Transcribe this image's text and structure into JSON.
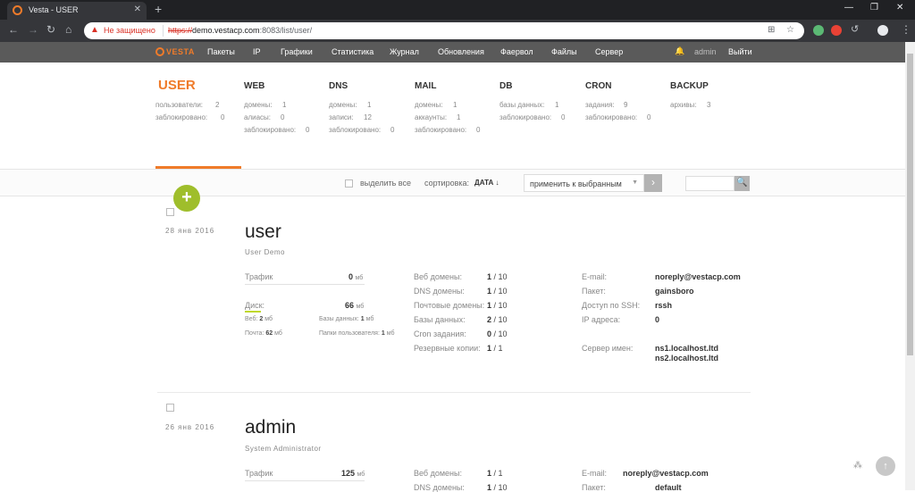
{
  "browser": {
    "tab_title": "Vesta - USER",
    "tab_close": "✕",
    "new_tab": "+",
    "insecure_label": "Не защищено",
    "url_scheme": "https://",
    "url_host": "demo.vestacp.com",
    "url_rest": ":8083/list/user/",
    "win_min": "—",
    "win_max": "❐",
    "win_close": "✕"
  },
  "topmenu": {
    "logo": "VESTA",
    "items": [
      "Пакеты",
      "IP",
      "Графики",
      "Статистика",
      "Журнал",
      "Обновления",
      "Фаервол",
      "Файлы",
      "Сервер"
    ],
    "user": "admin",
    "logout": "Выйти"
  },
  "categories": {
    "user": {
      "title": "USER",
      "l1": "пользователи:",
      "v1": "2",
      "l2": "заблокировано:",
      "v2": "0"
    },
    "web": {
      "title": "WEB",
      "l1": "домены:",
      "v1": "1",
      "l2": "алиасы:",
      "v2": "0",
      "l3": "заблокировано:",
      "v3": "0"
    },
    "dns": {
      "title": "DNS",
      "l1": "домены:",
      "v1": "1",
      "l2": "записи:",
      "v2": "12",
      "l3": "заблокировано:",
      "v3": "0"
    },
    "mail": {
      "title": "MAIL",
      "l1": "домены:",
      "v1": "1",
      "l2": "аккаунты:",
      "v2": "1",
      "l3": "заблокировано:",
      "v3": "0"
    },
    "db": {
      "title": "DB",
      "l1": "базы данных:",
      "v1": "1",
      "l2": "заблокировано:",
      "v2": "0"
    },
    "cron": {
      "title": "CRON",
      "l1": "задания:",
      "v1": "9",
      "l2": "заблокировано:",
      "v2": "0"
    },
    "backup": {
      "title": "BACKUP",
      "l1": "архивы:",
      "v1": "3"
    }
  },
  "toolbar": {
    "select_all": "выделить все",
    "sort_label": "сортировка:",
    "sort_value": "ДАТА ↓",
    "apply_label": "применить к выбранным",
    "apply_arrow": "▼",
    "apply_go": "›",
    "search_icon": "🔍"
  },
  "add_button": "+",
  "users": [
    {
      "date": "28 янв 2016",
      "name": "user",
      "desc": "User Demo",
      "traffic_label": "Трафик",
      "traffic_value": "0",
      "traffic_unit": "мб",
      "disk_label": "Диск:",
      "disk_value": "66",
      "disk_unit": "мб",
      "web_label": "Веб:",
      "web_value": "2",
      "web_unit": "мб",
      "db_label": "Базы данных:",
      "db_value": "1",
      "db_unit": "мб",
      "mail_label": "Почта:",
      "mail_value": "62",
      "mail_unit": "мб",
      "userdirs_label": "Папки пользователя:",
      "userdirs_value": "1",
      "userdirs_unit": "мб",
      "web_domains_label": "Веб домены:",
      "web_domains": "1",
      "web_domains_max": "/ 10",
      "dns_domains_label": "DNS домены:",
      "dns_domains": "1",
      "dns_domains_max": "/ 10",
      "mail_domains_label": "Почтовые домены:",
      "mail_domains": "1",
      "mail_domains_max": "/ 10",
      "databases_label": "Базы данных:",
      "databases": "2",
      "databases_max": "/ 10",
      "cron_label": "Cron задания:",
      "cron": "0",
      "cron_max": "/ 10",
      "backups_label": "Резервные копии:",
      "backups": "1",
      "backups_max": "/ 1",
      "email_label": "E-mail:",
      "email": "noreply@vestacp.com",
      "package_label": "Пакет:",
      "package": "gainsboro",
      "ssh_label": "Доступ по SSH:",
      "ssh": "rssh",
      "ip_label": "IP адреса:",
      "ip": "0",
      "ns_label": "Сервер имен:",
      "ns1": "ns1.localhost.ltd",
      "ns2": "ns2.localhost.ltd"
    },
    {
      "date": "26 янв 2016",
      "name": "admin",
      "desc": "System Administrator",
      "traffic_label": "Трафик",
      "traffic_value": "125",
      "traffic_unit": "мб",
      "web_domains_label": "Веб домены:",
      "web_domains": "1",
      "web_domains_max": "/ 1",
      "dns_domains_label": "DNS домены:",
      "dns_domains": "1",
      "dns_domains_max": "/ 10",
      "email_label": "E-mail:",
      "email": "noreply@vestacp.com",
      "package_label": "Пакет:",
      "package": "default"
    }
  ],
  "float": {
    "up": "↑",
    "dots": "⁂"
  },
  "colors": {
    "accent": "#ef7b2a",
    "topmenu": "#5a5a5a",
    "add": "#9fbe2b",
    "disk": "#c0d82d"
  }
}
